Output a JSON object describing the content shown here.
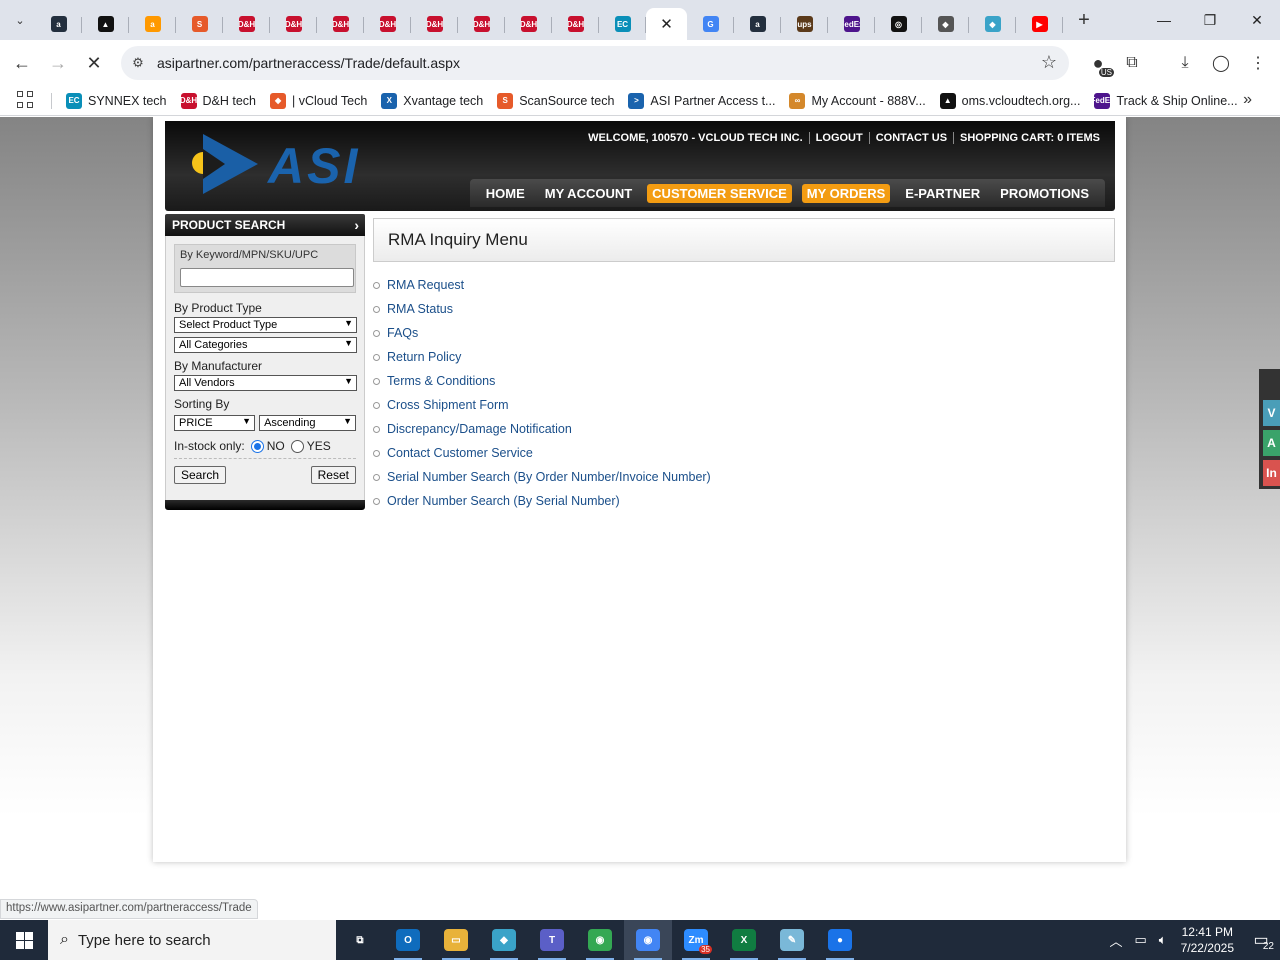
{
  "browser": {
    "tabs": [
      {
        "icon": "amazon-a-icon",
        "color": "#232f3e",
        "text": "a"
      },
      {
        "icon": "triangle-logo-icon",
        "color": "#111111",
        "text": "▲"
      },
      {
        "icon": "amazon-icon",
        "color": "#ff9900",
        "text": "a"
      },
      {
        "icon": "scansource-icon",
        "color": "#e65a2a",
        "text": "S"
      },
      {
        "icon": "dh-icon",
        "color": "#c8102e",
        "text": "D&H"
      },
      {
        "icon": "dh-icon",
        "color": "#c8102e",
        "text": "D&H"
      },
      {
        "icon": "dh-icon",
        "color": "#c8102e",
        "text": "D&H"
      },
      {
        "icon": "dh-icon",
        "color": "#c8102e",
        "text": "D&H"
      },
      {
        "icon": "dh-icon",
        "color": "#c8102e",
        "text": "D&H"
      },
      {
        "icon": "dh-icon",
        "color": "#c8102e",
        "text": "D&H"
      },
      {
        "icon": "dh-icon",
        "color": "#c8102e",
        "text": "D&H"
      },
      {
        "icon": "dh-icon",
        "color": "#c8102e",
        "text": "D&H"
      },
      {
        "icon": "synnex-ec-icon",
        "color": "#0a8fb8",
        "text": "EC"
      }
    ],
    "tabs_after": [
      {
        "icon": "google-icon",
        "color": "#4285f4",
        "text": "G"
      },
      {
        "icon": "amazon-a-icon",
        "color": "#232f3e",
        "text": "a"
      },
      {
        "icon": "ups-icon",
        "color": "#5b3a1a",
        "text": "ups"
      },
      {
        "icon": "fedex-icon",
        "color": "#4d148c",
        "text": "FedEx"
      },
      {
        "icon": "openai-icon",
        "color": "#111111",
        "text": "◎"
      },
      {
        "icon": "gaming-icon",
        "color": "#555555",
        "text": "◆"
      },
      {
        "icon": "diamond-icon",
        "color": "#3aa3c8",
        "text": "◆"
      },
      {
        "icon": "youtube-icon",
        "color": "#ff0000",
        "text": "▶"
      }
    ],
    "url": "asipartner.com/partneraccess/Trade/default.aspx",
    "profile_badge": "US",
    "bookmarks": [
      {
        "label": "SYNNEX tech",
        "icon": "synnex-ec-icon",
        "color": "#0a8fb8",
        "text": "EC"
      },
      {
        "label": "D&H tech",
        "icon": "dh-icon",
        "color": "#c8102e",
        "text": "D&H"
      },
      {
        "label": "| vCloud Tech",
        "icon": "vcloud-icon",
        "color": "#e65a2a",
        "text": "◆"
      },
      {
        "label": "Xvantage tech",
        "icon": "xvantage-icon",
        "color": "#1a63ad",
        "text": "X"
      },
      {
        "label": "ScanSource tech",
        "icon": "scansource-icon",
        "color": "#e65a2a",
        "text": "S"
      },
      {
        "label": "ASI Partner Access t...",
        "icon": "asi-icon",
        "color": "#1a63ad",
        "text": ">"
      },
      {
        "label": "My Account - 888V...",
        "icon": "myaccount-icon",
        "color": "#d4882b",
        "text": "∞"
      },
      {
        "label": "oms.vcloudtech.org...",
        "icon": "triangle-logo-icon",
        "color": "#111111",
        "text": "▲"
      },
      {
        "label": "Track & Ship Online...",
        "icon": "fedex-icon",
        "color": "#4d148c",
        "text": "FedEx"
      }
    ]
  },
  "site": {
    "logo_text": "ASI",
    "header_links": [
      "WELCOME, 100570 - VCLOUD TECH INC.",
      "LOGOUT",
      "CONTACT US",
      "SHOPPING CART: 0 ITEMS"
    ],
    "nav": [
      {
        "label": "HOME",
        "highlight": false
      },
      {
        "label": "MY ACCOUNT",
        "highlight": false
      },
      {
        "label": "CUSTOMER SERVICE",
        "highlight": true
      },
      {
        "label": "MY ORDERS",
        "highlight": true
      },
      {
        "label": "E-PARTNER",
        "highlight": false
      },
      {
        "label": "PROMOTIONS",
        "highlight": false
      }
    ],
    "accent_color": "#f39c12"
  },
  "product_search": {
    "title": "PRODUCT SEARCH",
    "keyword_label": "By Keyword/MPN/SKU/UPC",
    "keyword_value": "",
    "product_type_label": "By Product Type",
    "product_type_value": "Select Product Type",
    "category_value": "All Categories",
    "manufacturer_label": "By Manufacturer",
    "manufacturer_value": "All Vendors",
    "sorting_label": "Sorting By",
    "sort_field_value": "PRICE",
    "sort_order_value": "Ascending",
    "instock_label": "In-stock only:",
    "instock_no": "NO",
    "instock_yes": "YES",
    "instock_selected": "NO",
    "search_button": "Search",
    "reset_button": "Reset"
  },
  "content": {
    "title": "RMA Inquiry Menu",
    "links": [
      "RMA Request",
      "RMA Status",
      "FAQs",
      "Return Policy",
      "Terms & Conditions",
      "Cross Shipment Form",
      "Discrepancy/Damage Notification",
      "Contact Customer Service",
      "Serial Number Search (By Order Number/Invoice Number)",
      "Order Number Search (By Serial Number)"
    ]
  },
  "side_tabs": [
    {
      "text": "V",
      "color": "#4a9eb8"
    },
    {
      "text": "A",
      "color": "#3aa36a"
    },
    {
      "text": "In",
      "color": "#d9534f"
    }
  ],
  "status_url": "https://www.asipartner.com/partneraccess/Trade",
  "taskbar": {
    "search_placeholder": "Type here to search",
    "apps": [
      {
        "icon": "task-view-icon",
        "color": "#1f2a3a",
        "text": "⧉",
        "active": false
      },
      {
        "icon": "outlook-icon",
        "color": "#0f6cbd",
        "text": "O",
        "active": false
      },
      {
        "icon": "file-explorer-icon",
        "color": "#e8b23a",
        "text": "▭",
        "active": false
      },
      {
        "icon": "diamond-app-icon",
        "color": "#3aa3c8",
        "text": "◆",
        "active": false
      },
      {
        "icon": "teams-icon",
        "color": "#5b5fc7",
        "text": "T",
        "active": false
      },
      {
        "icon": "chrome-icon",
        "color": "#34a853",
        "text": "◉",
        "active": false
      },
      {
        "icon": "chrome-profile-icon",
        "color": "#4285f4",
        "text": "◉",
        "active": true
      },
      {
        "icon": "zoom-icon",
        "color": "#2d8cff",
        "text": "Zm",
        "active": false
      },
      {
        "icon": "excel-icon",
        "color": "#107c41",
        "text": "X",
        "active": false
      },
      {
        "icon": "notepad-icon",
        "color": "#7ab8d8",
        "text": "✎",
        "active": false
      },
      {
        "icon": "blue-app-icon",
        "color": "#1a73e8",
        "text": "●",
        "active": false
      }
    ],
    "zoom_badge": "35",
    "time": "12:41 PM",
    "date": "7/22/2025",
    "notification_count": "22"
  }
}
